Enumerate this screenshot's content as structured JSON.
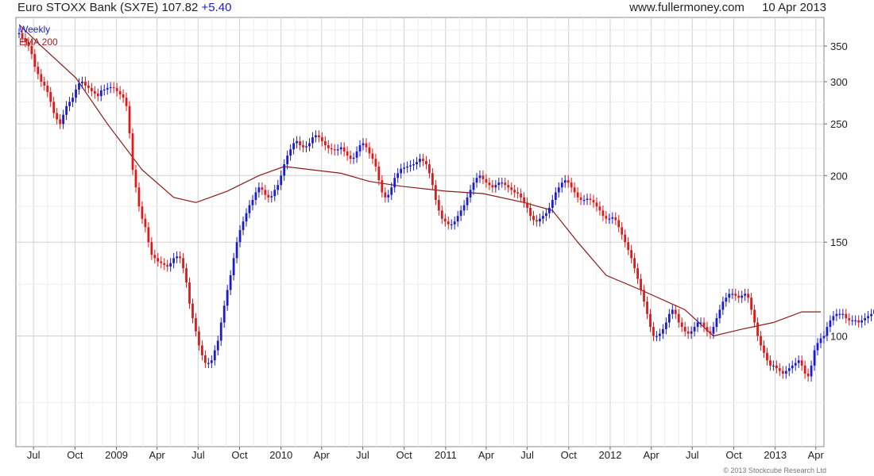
{
  "header": {
    "title": "Euro STOXX Bank (SX7E) 107.82",
    "change": "+5.40",
    "site": "www.fullermoney.com",
    "date": "10 Apr 2013"
  },
  "footer": {
    "copyright": "© 2013 Stockcube Research Ltd"
  },
  "colors": {
    "up": "#1b1bd0",
    "down": "#e01818",
    "ema": "#8b1a1a",
    "grid": "#d0d0d0",
    "axis": "#666666"
  },
  "chart_data": {
    "type": "line",
    "title": "Euro STOXX Bank (SX7E) 107.82 +5.40",
    "y_scale": "log",
    "ylim": [
      62,
      396
    ],
    "yticks": [
      100,
      150,
      200,
      250,
      300,
      350
    ],
    "x_tick_labels": [
      "Jul",
      "Oct",
      "2009",
      "Apr",
      "Jul",
      "Oct",
      "2010",
      "Apr",
      "Jul",
      "Oct",
      "2011",
      "Apr",
      "Jul",
      "Oct",
      "2012",
      "Apr",
      "Jul",
      "Oct",
      "2013",
      "Apr"
    ],
    "x_start": "2008-05-30",
    "x_end": "2013-04-12",
    "legend": [
      "Weekly",
      "EMA 200"
    ],
    "legend_position": "top-left",
    "grid": true,
    "series": [
      {
        "name": "Weekly",
        "x_start": "2008-05-30",
        "interval_days": 7,
        "values": [
          370,
          362,
          356,
          350,
          338,
          320,
          310,
          300,
          295,
          287,
          275,
          262,
          255,
          250,
          260,
          270,
          275,
          280,
          290,
          298,
          300,
          295,
          292,
          288,
          285,
          282,
          289,
          290,
          292,
          293,
          292,
          288,
          284,
          280,
          270,
          240,
          205,
          190,
          175,
          166,
          160,
          150,
          142,
          140,
          138,
          137,
          136,
          135,
          137,
          140,
          141,
          140,
          134,
          126,
          115,
          108,
          102,
          96,
          92,
          89,
          89,
          90,
          94,
          98,
          106,
          114,
          122,
          130,
          140,
          150,
          158,
          164,
          170,
          176,
          180,
          186,
          190,
          188,
          184,
          182,
          183,
          188,
          192,
          200,
          210,
          218,
          224,
          230,
          232,
          228,
          226,
          227,
          230,
          236,
          238,
          236,
          232,
          228,
          225,
          224,
          223,
          224,
          226,
          222,
          218,
          215,
          216,
          222,
          228,
          230,
          226,
          220,
          215,
          208,
          196,
          186,
          182,
          184,
          190,
          198,
          202,
          206,
          207,
          208,
          209,
          210,
          212,
          215,
          213,
          210,
          202,
          192,
          180,
          172,
          166,
          164,
          162,
          162,
          164,
          168,
          172,
          176,
          182,
          188,
          194,
          198,
          200,
          197,
          194,
          192,
          190,
          192,
          194,
          194,
          192,
          190,
          188,
          186,
          185,
          182,
          178,
          174,
          168,
          165,
          164,
          166,
          168,
          170,
          174,
          180,
          186,
          190,
          194,
          196,
          194,
          190,
          186,
          182,
          180,
          180,
          181,
          180,
          178,
          175,
          172,
          168,
          166,
          166,
          167,
          165,
          160,
          155,
          150,
          145,
          140,
          134,
          128,
          122,
          116,
          110,
          104,
          100,
          100,
          101,
          103,
          106,
          110,
          112,
          110,
          106,
          104,
          102,
          101,
          102,
          104,
          106,
          106,
          104,
          102,
          101,
          104,
          108,
          112,
          116,
          118,
          120,
          120,
          119,
          118,
          119,
          120,
          118,
          112,
          106,
          100,
          96,
          93,
          90,
          88,
          88,
          87,
          86,
          85,
          86,
          87,
          88,
          89,
          90,
          88,
          85,
          84,
          88,
          94,
          97,
          99,
          100,
          104,
          107,
          109,
          110,
          110,
          110,
          108,
          107,
          107,
          107,
          106,
          107,
          108,
          109,
          110,
          112,
          113,
          114,
          116,
          120,
          124,
          126,
          126,
          124,
          122,
          120,
          119,
          117,
          115,
          113,
          110,
          106,
          104,
          104,
          107.82
        ]
      }
    ],
    "ema_200": {
      "name": "EMA 200",
      "points": [
        [
          "2008-05-30",
          384
        ],
        [
          "2008-07-18",
          350
        ],
        [
          "2008-10-03",
          305
        ],
        [
          "2008-12-12",
          250
        ],
        [
          "2009-02-27",
          205
        ],
        [
          "2009-05-08",
          182
        ],
        [
          "2009-06-26",
          178
        ],
        [
          "2009-09-04",
          187
        ],
        [
          "2009-11-13",
          200
        ],
        [
          "2010-01-08",
          208
        ],
        [
          "2010-03-12",
          205
        ],
        [
          "2010-05-14",
          202
        ],
        [
          "2010-07-16",
          195
        ],
        [
          "2010-09-24",
          191
        ],
        [
          "2010-12-31",
          187
        ],
        [
          "2011-03-25",
          185
        ],
        [
          "2011-06-24",
          178
        ],
        [
          "2011-08-26",
          172
        ],
        [
          "2011-10-21",
          150
        ],
        [
          "2011-12-23",
          130
        ],
        [
          "2012-03-09",
          122
        ],
        [
          "2012-06-15",
          112
        ],
        [
          "2012-08-17",
          100
        ],
        [
          "2012-10-19",
          103
        ],
        [
          "2012-12-28",
          106
        ],
        [
          "2013-03-01",
          111
        ],
        [
          "2013-04-12",
          111
        ]
      ]
    }
  }
}
